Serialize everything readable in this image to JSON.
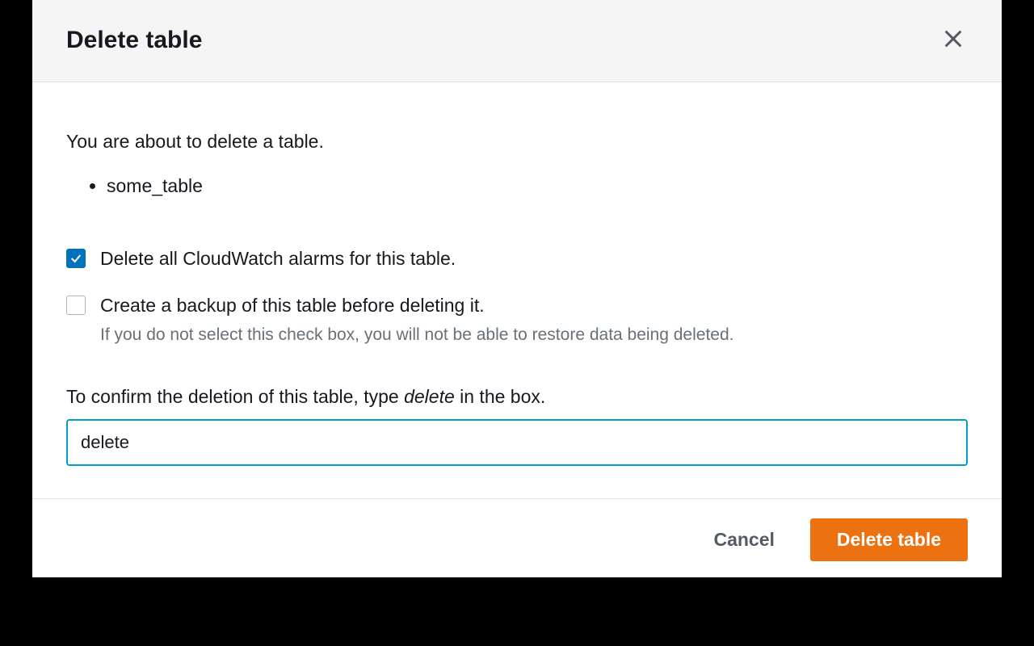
{
  "dialog": {
    "title": "Delete table",
    "intro": "You are about to delete a table.",
    "tables": [
      "some_table"
    ],
    "options": {
      "delete_alarms": {
        "label": "Delete all CloudWatch alarms for this table.",
        "checked": true
      },
      "create_backup": {
        "label": "Create a backup of this table before deleting it.",
        "hint": "If you do not select this check box, you will not be able to restore data being deleted.",
        "checked": false
      }
    },
    "confirm": {
      "label_prefix": "To confirm the deletion of this table, type ",
      "keyword": "delete",
      "label_suffix": " in the box.",
      "value": "delete"
    },
    "actions": {
      "cancel": "Cancel",
      "submit": "Delete table"
    }
  }
}
